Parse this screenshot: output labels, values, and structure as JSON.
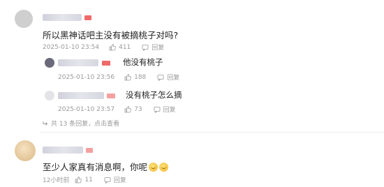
{
  "comments": [
    {
      "text": "所以黑神话吧主没有被摘桃子对吗?",
      "date": "2025-01-10 23:54",
      "likes": "411",
      "reply_label": "回复"
    },
    {
      "text": "至少人家真有消息啊，你呢",
      "date": "12小时前",
      "likes": "11",
      "reply_label": "回复",
      "emojis": [
        "face-emoji",
        "face-emoji"
      ]
    }
  ],
  "replies": [
    {
      "text": "他没有桃子",
      "date": "2025-01-10 23:56",
      "likes": "188",
      "reply_label": "回复"
    },
    {
      "text": "没有桃子怎么摘",
      "date": "2025-01-10 23:57",
      "likes": "73",
      "reply_label": "回复"
    }
  ],
  "more_replies": "共 13 条回复，点击查看",
  "colors": {
    "badge_red": "#f06a6a",
    "meta_gray": "#9a9a9a",
    "text": "#222222"
  }
}
